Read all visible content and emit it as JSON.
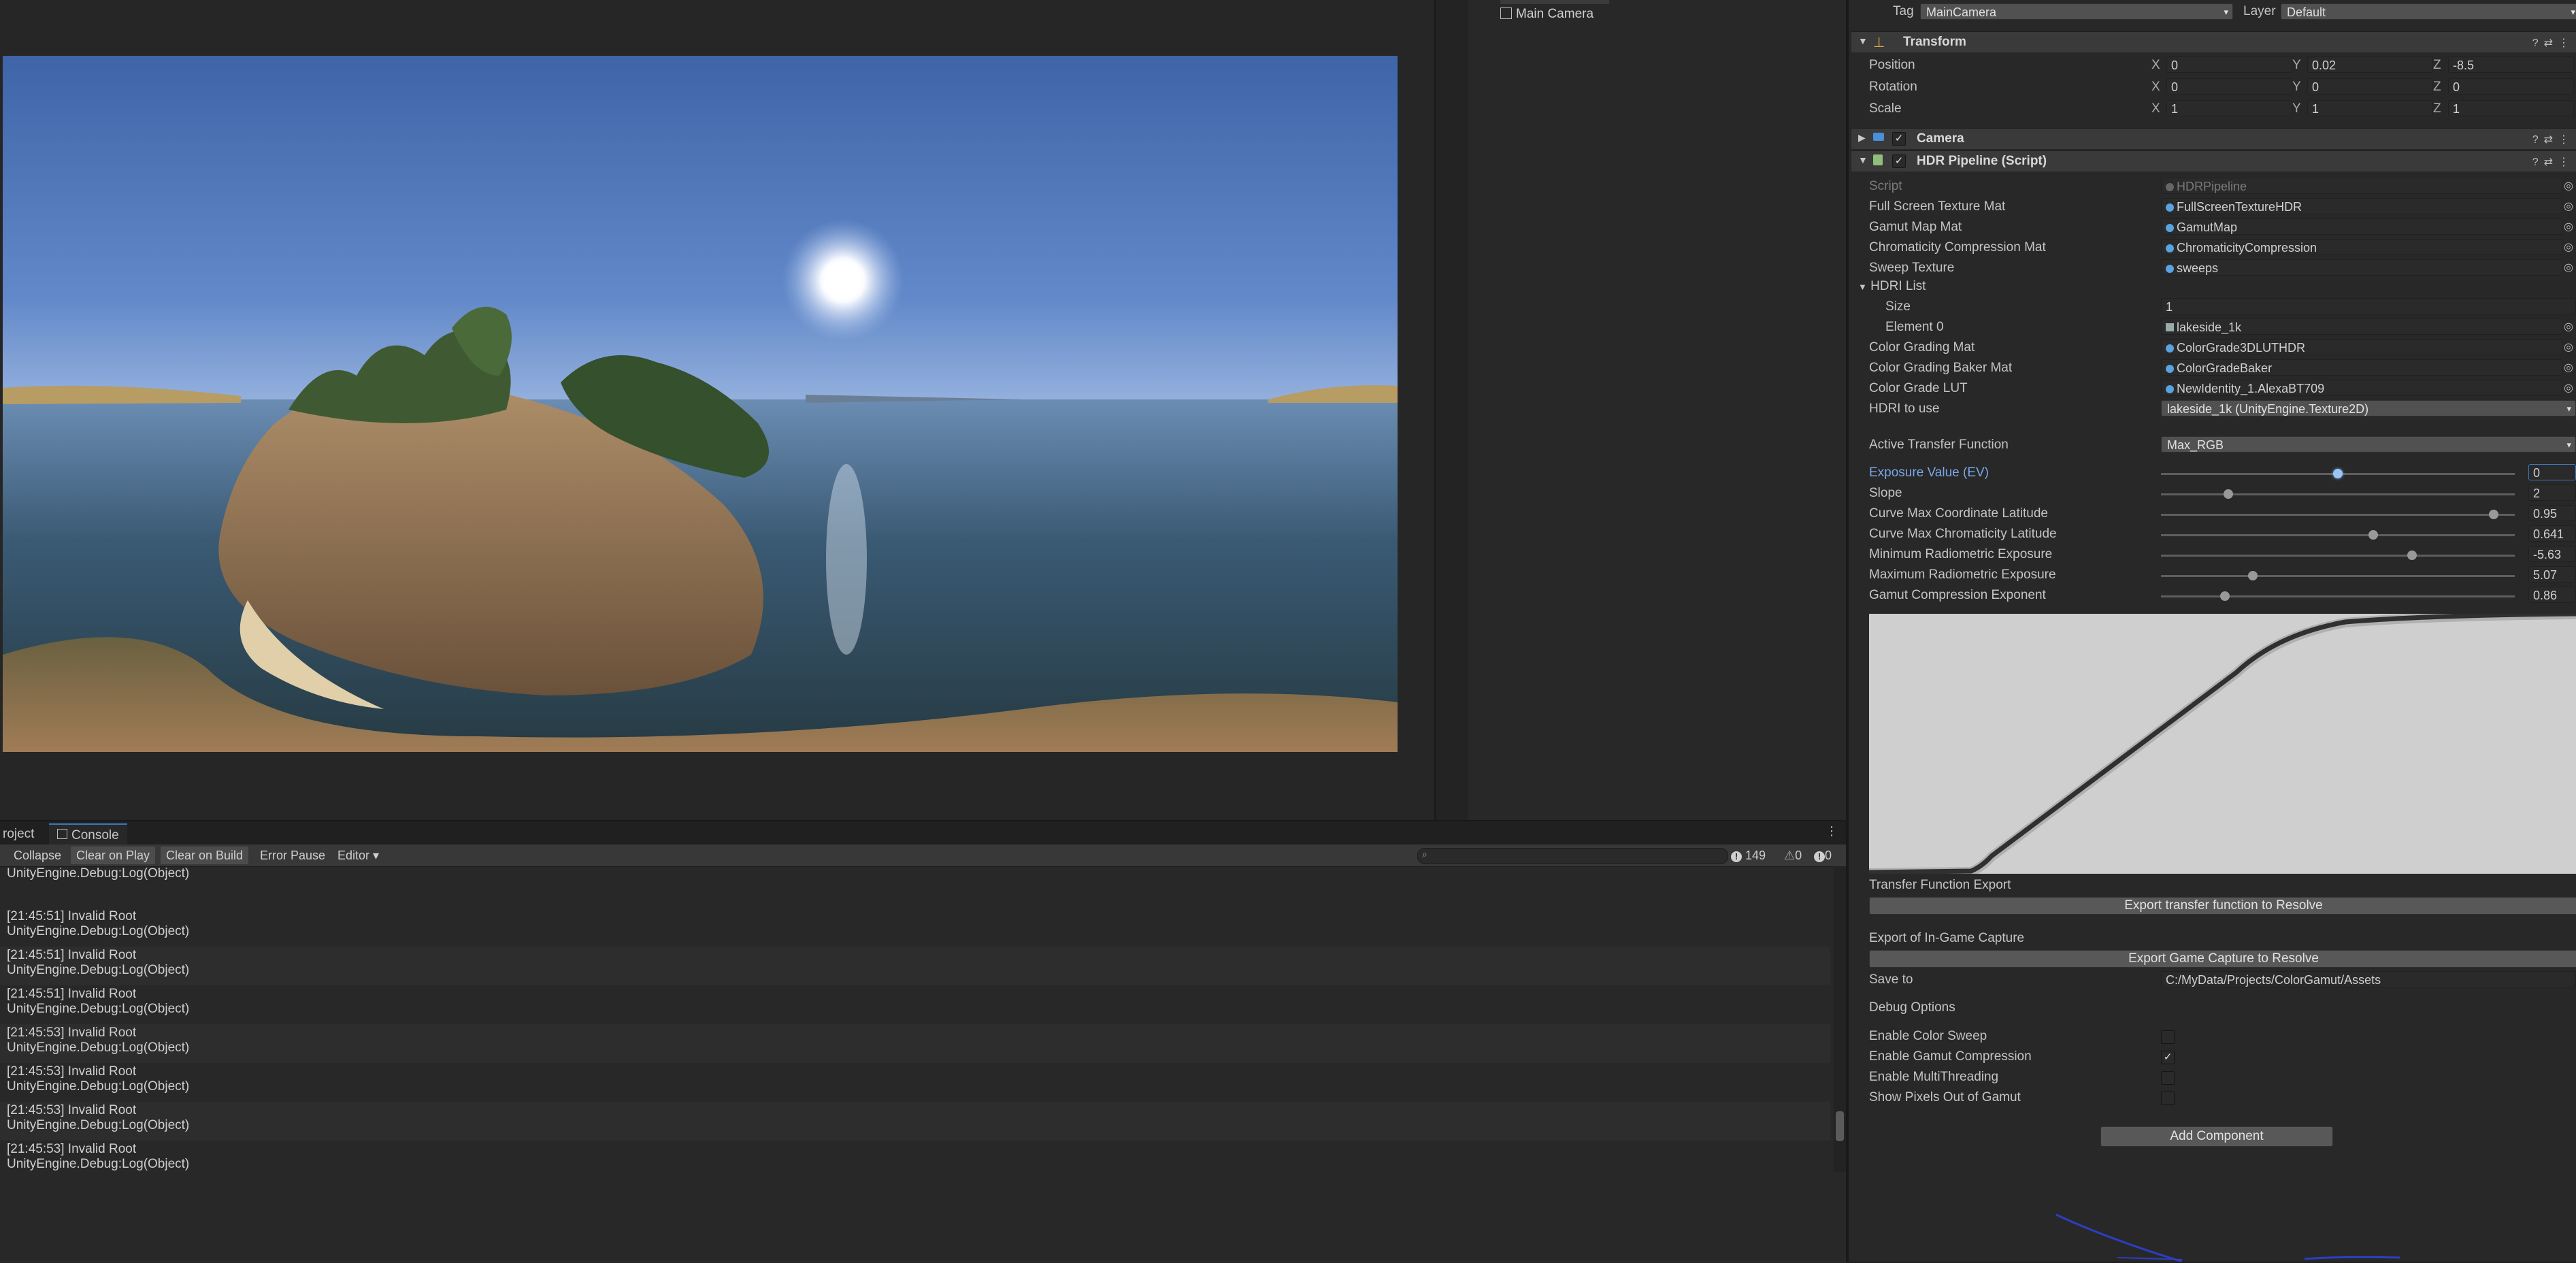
{
  "hierarchy": {
    "items": [
      "Main Camera"
    ]
  },
  "console": {
    "tabs": [
      "roject",
      "Console"
    ],
    "toolbar": {
      "collapse": "Collapse",
      "clear_on_play": "Clear on Play",
      "clear_on_build": "Clear on Build",
      "error_pause": "Error Pause",
      "editor": "Editor"
    },
    "counts": {
      "info": "149",
      "warn": "0",
      "error": "0"
    },
    "first_line": "UnityEngine.Debug:Log(Object)",
    "rows": [
      {
        "msg": "[21:45:51] Invalid Root",
        "trace": "UnityEngine.Debug:Log(Object)"
      },
      {
        "msg": "[21:45:51] Invalid Root",
        "trace": "UnityEngine.Debug:Log(Object)"
      },
      {
        "msg": "[21:45:51] Invalid Root",
        "trace": "UnityEngine.Debug:Log(Object)"
      },
      {
        "msg": "[21:45:53] Invalid Root",
        "trace": "UnityEngine.Debug:Log(Object)"
      },
      {
        "msg": "[21:45:53] Invalid Root",
        "trace": "UnityEngine.Debug:Log(Object)"
      },
      {
        "msg": "[21:45:53] Invalid Root",
        "trace": "UnityEngine.Debug:Log(Object)"
      },
      {
        "msg": "[21:45:53] Invalid Root",
        "trace": "UnityEngine.Debug:Log(Object)"
      }
    ]
  },
  "inspector": {
    "tag_label": "Tag",
    "tag_value": "MainCamera",
    "layer_label": "Layer",
    "layer_value": "Default",
    "transform": {
      "title": "Transform",
      "rows": [
        {
          "label": "Position",
          "x": "0",
          "y": "0.02",
          "z": "-8.5"
        },
        {
          "label": "Rotation",
          "x": "0",
          "y": "0",
          "z": "0"
        },
        {
          "label": "Scale",
          "x": "1",
          "y": "1",
          "z": "1"
        }
      ],
      "axis": {
        "x": "X",
        "y": "Y",
        "z": "Z"
      }
    },
    "camera_title": "Camera",
    "hdr_title": "HDR Pipeline (Script)",
    "props": [
      {
        "label": "Script",
        "value": "HDRPipeline"
      },
      {
        "label": "Full Screen Texture Mat",
        "value": "FullScreenTextureHDR"
      },
      {
        "label": "Gamut Map Mat",
        "value": "GamutMap"
      },
      {
        "label": "Chromaticity Compression Mat",
        "value": "ChromaticityCompression"
      },
      {
        "label": "Sweep Texture",
        "value": "sweeps"
      }
    ],
    "hdri_list": {
      "label": "HDRI List",
      "size_label": "Size",
      "size_value": "1",
      "element_label": "Element 0",
      "element_value": "lakeside_1k"
    },
    "props2": [
      {
        "label": "Color Grading Mat",
        "value": "ColorGrade3DLUTHDR"
      },
      {
        "label": "Color Grading Baker Mat",
        "value": "ColorGradeBaker"
      },
      {
        "label": "Color Grade LUT",
        "value": "NewIdentity_1.AlexaBT709"
      }
    ],
    "hdri_to_use": {
      "label": "HDRI to use",
      "value": "lakeside_1k (UnityEngine.Texture2D)"
    },
    "active_tf": {
      "label": "Active Transfer Function",
      "value": "Max_RGB"
    },
    "sliders": [
      {
        "label": "Exposure Value (EV)",
        "value": "0",
        "frac": 0.5
      },
      {
        "label": "Slope",
        "value": "2",
        "frac": 0.19
      },
      {
        "label": "Curve Max Coordinate Latitude",
        "value": "0.95",
        "frac": 0.94
      },
      {
        "label": "Curve Max Chromaticity Latitude",
        "value": "0.641",
        "frac": 0.6
      },
      {
        "label": "Minimum Radiometric Exposure",
        "value": "-5.63",
        "frac": 0.71
      },
      {
        "label": "Maximum Radiometric Exposure",
        "value": "5.07",
        "frac": 0.26
      },
      {
        "label": "Gamut Compression Exponent",
        "value": "0.86",
        "frac": 0.18
      }
    ],
    "tf_export_label": "Transfer Function Export",
    "tf_export_button": "Export transfer function to Resolve",
    "capture_label": "Export of In-Game Capture",
    "capture_button": "Export Game Capture to Resolve",
    "save_to_label": "Save to",
    "save_to_value": "C:/MyData/Projects/ColorGamut/Assets",
    "debug_label": "Debug Options",
    "checkboxes": [
      {
        "label": "Enable Color Sweep",
        "checked": false
      },
      {
        "label": "Enable Gamut Compression",
        "checked": true
      },
      {
        "label": "Enable MultiThreading",
        "checked": false
      },
      {
        "label": "Show Pixels Out of Gamut",
        "checked": false
      }
    ],
    "add_component": "Add Component"
  },
  "colors": {
    "accent": "#3a79bb",
    "highlight_label": "#7aa6e8",
    "panel": "#282828",
    "curve_bg": "#cfcfcf"
  }
}
